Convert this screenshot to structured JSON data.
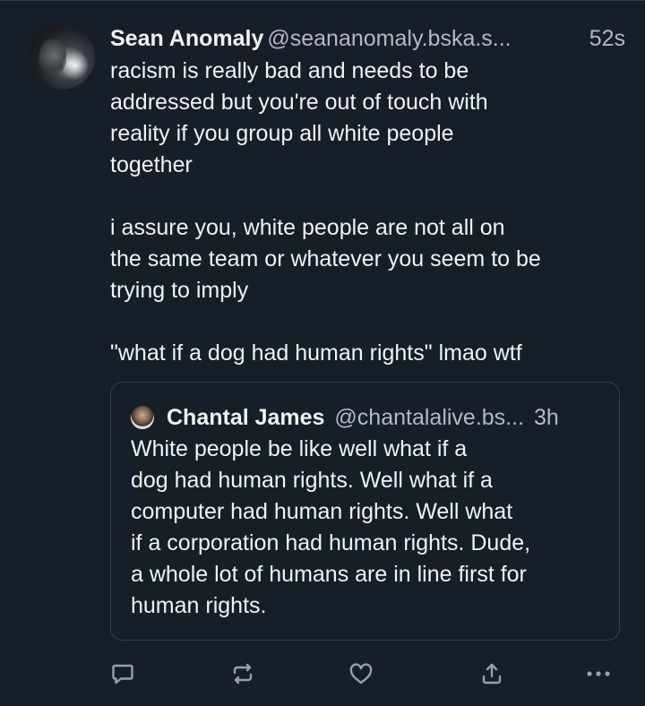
{
  "post": {
    "author": {
      "display_name": "Sean Anomaly",
      "handle": "@seananomaly.bska.s...",
      "timestamp": "52s"
    },
    "text": "racism is really bad and needs to be\naddressed but you're out of touch with\nreality if you group all white people\ntogether\n\ni assure you, white people are not all on\nthe same team or whatever you seem to be\ntrying to imply\n\n\"what if a dog had human rights\" lmao wtf",
    "quote": {
      "author": {
        "display_name": "Chantal James",
        "handle": "@chantalalive.bs...",
        "timestamp": "3h"
      },
      "text": "White people be like well what if a\ndog had human rights. Well what if a\ncomputer had human rights. Well what\nif a corporation had human rights. Dude,\na whole lot of humans are in line first for\nhuman rights."
    }
  },
  "actions": {
    "icons": [
      "reply-icon",
      "repost-icon",
      "like-icon",
      "share-icon",
      "more-icon"
    ]
  },
  "colors": {
    "background": "#161e27",
    "text": "#f1f3f5",
    "muted_text": "#aebbc9",
    "border": "#2e4052",
    "icon": "#8fa3b8"
  }
}
